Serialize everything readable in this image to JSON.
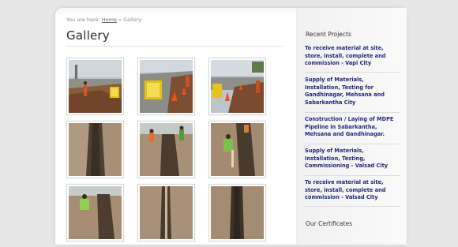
{
  "breadcrumb": {
    "prefix": "You are here:",
    "home": "Home",
    "separator": "»",
    "current": "Gallery"
  },
  "page": {
    "title": "Gallery"
  },
  "gallery": {
    "images": [
      {
        "name": "gallery-image-1"
      },
      {
        "name": "gallery-image-2"
      },
      {
        "name": "gallery-image-3"
      },
      {
        "name": "gallery-image-4"
      },
      {
        "name": "gallery-image-5"
      },
      {
        "name": "gallery-image-6"
      },
      {
        "name": "gallery-image-7"
      },
      {
        "name": "gallery-image-8"
      },
      {
        "name": "gallery-image-9"
      }
    ]
  },
  "sidebar": {
    "recent_title": "Recent Projects",
    "projects": [
      {
        "label": "To receive material at site, store, install, complete and commission - Vapi City"
      },
      {
        "label": "Supply of Materials, Installation, Testing for Gandhinagar, Mehsana and Sabarkantha City"
      },
      {
        "label": "Construction / Laying of MDPE Pipeline in Sabarkantha, Mehsana and Gandhinagar."
      },
      {
        "label": "Supply of Materials, Installation, Testing, Commissioning - Valsad City"
      },
      {
        "label": "To receive material at site, store, install, complete and commission - Valsad City"
      }
    ],
    "certificates_title": "Our Certificates"
  }
}
